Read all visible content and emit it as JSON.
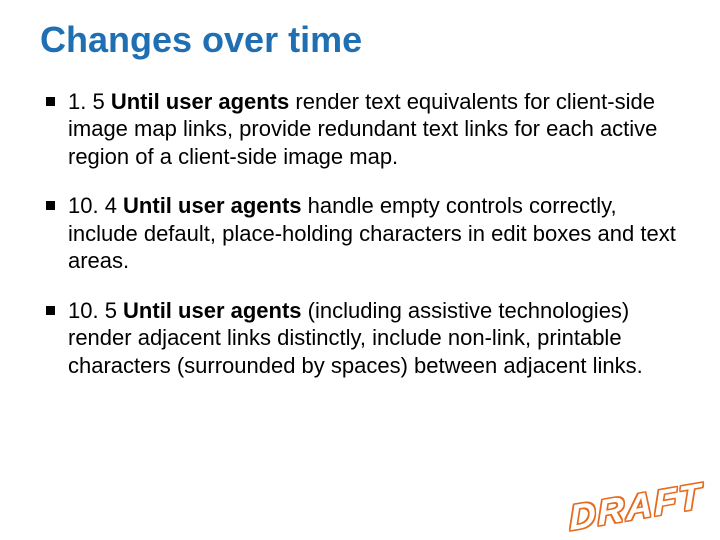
{
  "title": "Changes over time",
  "bullets": [
    {
      "prefix": "1. 5 ",
      "emphasis": "Until user agents",
      "rest": " render text equivalents for client-side image map links, provide redundant text links for each active region of a client-side image map."
    },
    {
      "prefix": "10. 4 ",
      "emphasis": "Until user agents",
      "rest": " handle empty controls correctly, include default, place-holding characters in edit boxes and text areas."
    },
    {
      "prefix": "10. 5 ",
      "emphasis": "Until user agents",
      "rest": " (including assistive technologies) render adjacent links distinctly, include non-link, printable characters (surrounded by spaces) between adjacent links."
    }
  ],
  "watermark": "DRAFT"
}
